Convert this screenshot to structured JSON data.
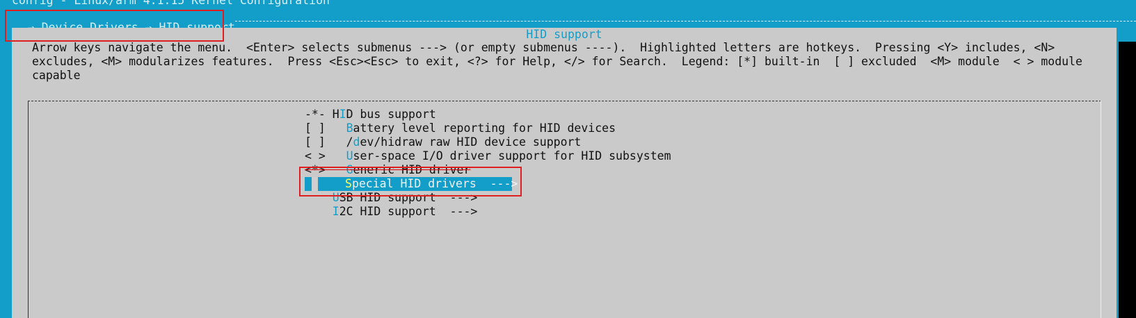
{
  "window": {
    "title": "config - Linux/arm 4.1.15 Kernel Configuration"
  },
  "breadcrumb": {
    "arrow1": "→",
    "part1": "Device Drivers",
    "arrow2": "→",
    "part2": "HID support"
  },
  "dialog": {
    "title": "HID support",
    "instructions": [
      "Arrow keys navigate the menu.  <Enter> selects submenus ---> (or empty submenus ----).  Highlighted letters are hotkeys.  Pressing <Y> includes, <N>",
      "excludes, <M> modularizes features.  Press <Esc><Esc> to exit, <?> for Help, </> for Search.  Legend: [*] built-in  [ ] excluded  <M> module  < > module",
      "capable"
    ]
  },
  "menu": {
    "items": [
      {
        "prefix": "-*- ",
        "pre": "H",
        "hotkey": "I",
        "rest": "D bus support"
      },
      {
        "prefix": "[ ]   ",
        "pre": "",
        "hotkey": "B",
        "rest": "attery level reporting for HID devices"
      },
      {
        "prefix": "[ ]   ",
        "pre": "/",
        "hotkey": "d",
        "rest": "ev/hidraw raw HID device support"
      },
      {
        "prefix": "< >   ",
        "pre": "",
        "hotkey": "U",
        "rest": "ser-space I/O driver support for HID subsystem"
      },
      {
        "prefix": "<*>   ",
        "pre": "",
        "hotkey": "G",
        "rest": "eneric HID driver"
      },
      {
        "prefix": "",
        "pre": "",
        "hotkey": "S",
        "rest": "pecial HID drivers  --->",
        "selected": true
      },
      {
        "prefix": "    ",
        "pre": "",
        "hotkey": "U",
        "rest": "SB HID support  --->"
      },
      {
        "prefix": "    ",
        "pre": "",
        "hotkey": "I",
        "rest": "2C HID support  --->"
      }
    ]
  },
  "colors": {
    "background": "#139ec9",
    "dialog": "#cacaca",
    "hotkey": "#139ec9",
    "selected_bar": "#139ec9",
    "annotation": "#e02020"
  }
}
